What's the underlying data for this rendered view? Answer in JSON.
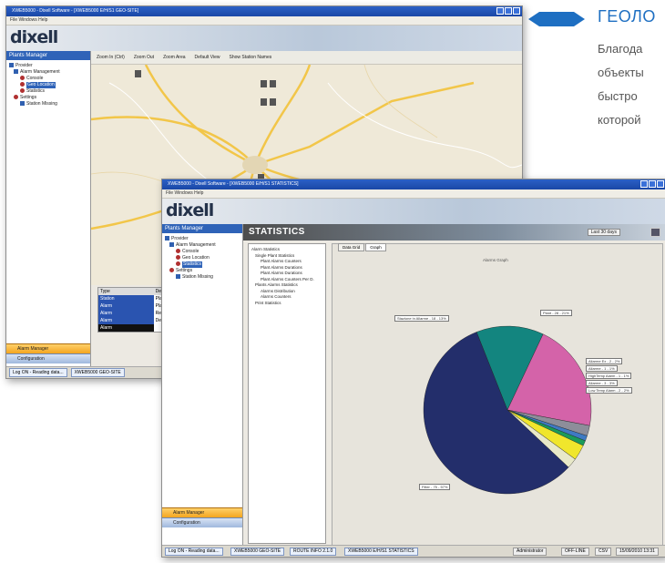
{
  "promo": {
    "title": "ГЕОЛО",
    "lines": [
      "Благода",
      "объекты",
      "быстро",
      "которой"
    ]
  },
  "map_window": {
    "title": "XWEB5000 - Dixell Software - [XWEB5000 E/H/S1 GEO-SITE]",
    "menu": "File   Windows   Help",
    "logo": "dixell",
    "sidebar_title": "Plants Manager",
    "tree": [
      {
        "label": "Provider",
        "level": 0
      },
      {
        "label": "Alarm Management",
        "level": 1
      },
      {
        "label": "Console",
        "level": 2
      },
      {
        "label": "Geo Location",
        "level": 2,
        "selected": true
      },
      {
        "label": "Statistics",
        "level": 2
      },
      {
        "label": "Settings",
        "level": 1
      },
      {
        "label": "Station Missing",
        "level": 2
      }
    ],
    "toolbar": [
      "Zoom In (Ctrl)",
      "Zoom Out",
      "Zoom Area",
      "Default View",
      "Show Station Names"
    ],
    "table": {
      "headers": [
        "Type",
        "Description"
      ],
      "rows": [
        [
          "Station",
          "Plant"
        ],
        [
          "Alarm",
          "Plant"
        ],
        [
          "Alarm",
          "Refrigerator"
        ],
        [
          "Alarm",
          "Dependent"
        ],
        [
          "Alarm",
          ""
        ]
      ]
    },
    "nav_buttons": [
      "Alarm Manager",
      "Configuration"
    ],
    "taskbar": [
      "Log ON - Reading data...",
      "XWEB5000 GEO-SITE"
    ]
  },
  "stats_window": {
    "title": "XWEB5000 - Dixell Software - [XWEB5000 E/H/S1 STATISTICS]",
    "menu": "File   Windows   Help",
    "logo": "dixell",
    "sidebar_title": "Plants Manager",
    "tree": [
      {
        "label": "Provider",
        "level": 0
      },
      {
        "label": "Alarm Management",
        "level": 1
      },
      {
        "label": "Console",
        "level": 2
      },
      {
        "label": "Geo Location",
        "level": 2
      },
      {
        "label": "Statistics",
        "level": 2,
        "selected": true
      },
      {
        "label": "Settings",
        "level": 1
      },
      {
        "label": "Station Missing",
        "level": 2
      }
    ],
    "header_title": "STATISTICS",
    "header_filter": "Last 30 days",
    "stats_tree": [
      "Alarm Statistics",
      "Single Plant Statistics",
      "Plant Alarms Counters",
      "Plant Alarms Durations",
      "Plant Alarms Durations",
      "Plant Alarms Counters Per D.",
      "Plants Alarms Statistics",
      "Alarms Distribution",
      "Alarms Counters",
      "Print Statistics"
    ],
    "tabs": [
      "Data Grid",
      "Graph"
    ],
    "chart_title": "Alarms Graph",
    "callouts": [
      "Stazione in Allarme - 18 - 13%",
      "Plant - 28 - 21%",
      "Allarme Ex - 2 - 2%",
      "Allarme - 1 - 1%",
      "HighTemp Alarm - 1 - 1%",
      "Allarme - 3 - 3%",
      "Low Temp Alarm - 2 - 2%",
      "Filter - 75 - 57%"
    ],
    "nav_buttons": [
      "Alarm Manager",
      "Configuration"
    ],
    "taskbar": [
      "Log ON - Reading data...",
      "XWEB5000 GEO-SITE",
      "ROUTE INFO 2.1.0",
      "XWEB5000 E/H/S1 STATISTICS"
    ],
    "status_right": [
      "Administrator",
      "OFF-LINE",
      "CSV",
      "15/09/2010 13:31"
    ]
  },
  "chart_data": {
    "type": "pie",
    "title": "Alarms Graph",
    "slices": [
      {
        "label": "Filter - 75 - 57%",
        "value": 57,
        "color": "#232e6b"
      },
      {
        "label": "Stazione in Allarme - 18 - 13%",
        "value": 13,
        "color": "#13857f"
      },
      {
        "label": "Plant - 28 - 21%",
        "value": 21,
        "color": "#d463a9"
      },
      {
        "label": "Allarme Ex - 2 - 2%",
        "value": 2,
        "color": "#8d8e9a"
      },
      {
        "label": "Allarme - 1 - 1%",
        "value": 1,
        "color": "#3f7ac3"
      },
      {
        "label": "HighTemp Alarm - 1 - 1%",
        "value": 1,
        "color": "#1a9b5a"
      },
      {
        "label": "Allarme - 3 - 3%",
        "value": 3,
        "color": "#f0e62c"
      },
      {
        "label": "Low Temp Alarm - 2 - 2%",
        "value": 2,
        "color": "#e8e8c8"
      }
    ]
  }
}
